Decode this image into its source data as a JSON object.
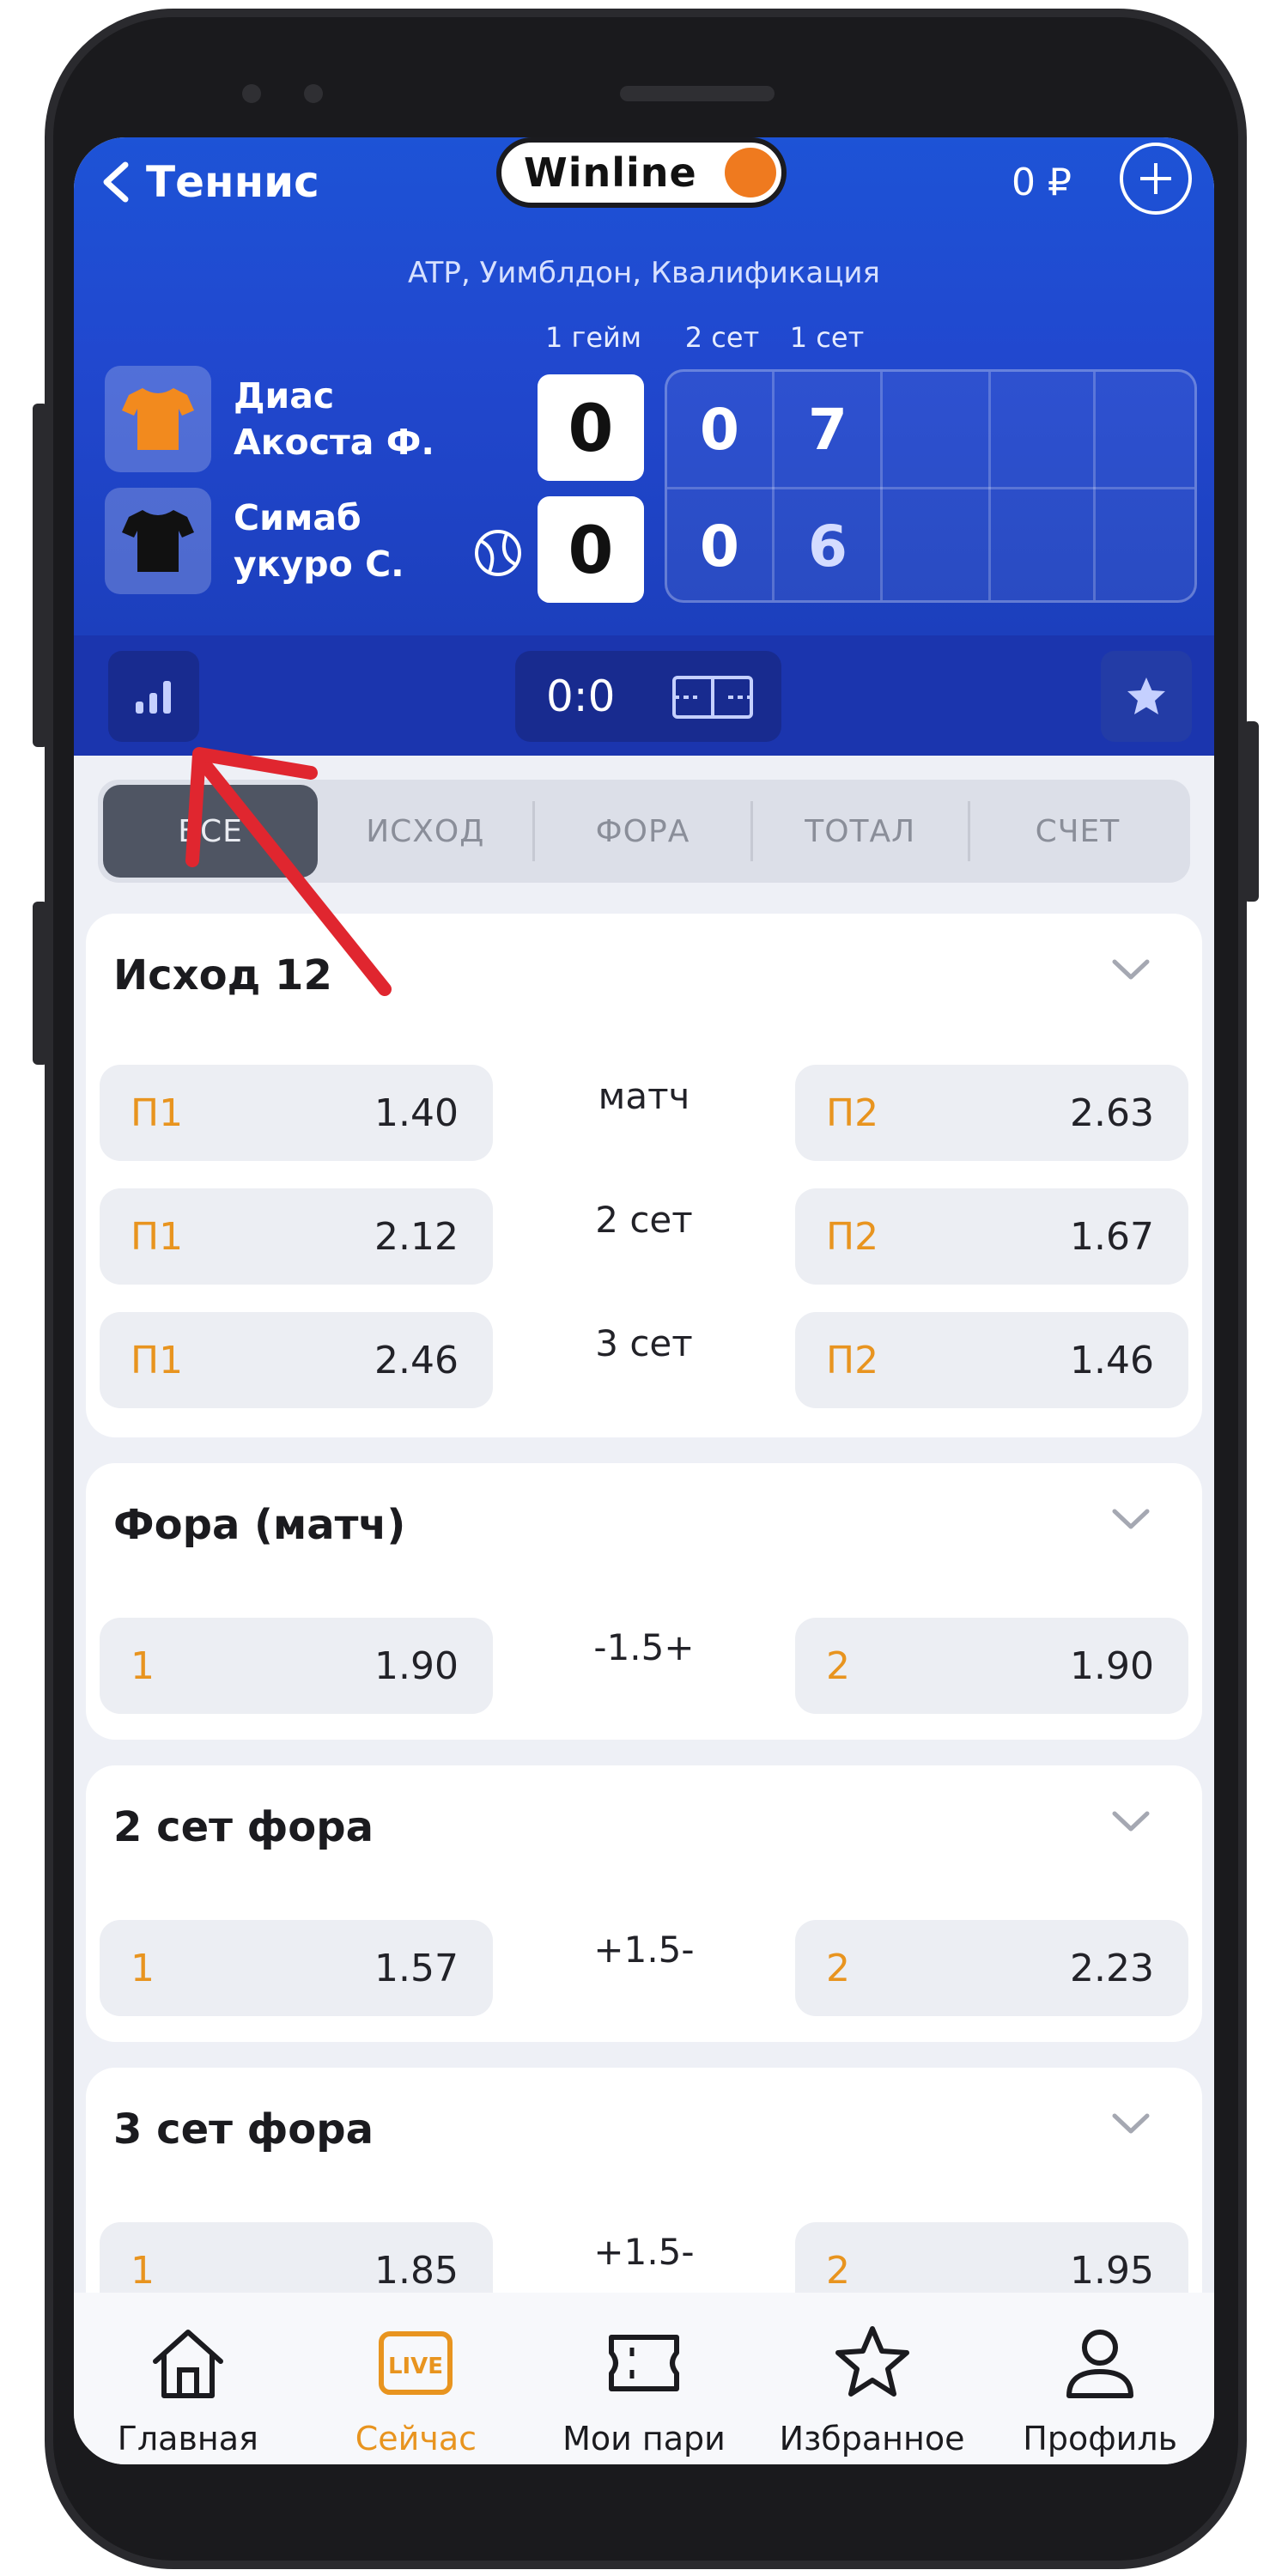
{
  "header": {
    "back_label": "Теннис",
    "logo_text": "Winline",
    "balance": "0 ₽",
    "tournament": "ATP, Уимблдон, Квалификация",
    "columns": {
      "game": "1 гейм",
      "set2": "2 сет",
      "set1": "1 сет"
    },
    "players": [
      {
        "name": "Диас\nАкоста Ф.",
        "game_score": "0",
        "set2": "0",
        "set1": "7",
        "jersey_color": "#f28a1e"
      },
      {
        "name": "Симаб\nукуро С.",
        "game_score": "0",
        "set2": "0",
        "set1": "6",
        "jersey_color": "#111111",
        "serving": true
      }
    ],
    "current_score": "0:0"
  },
  "tabs": [
    "ВСЕ",
    "ИСХОД",
    "ФОРА",
    "ТОТАЛ",
    "СЧЕТ"
  ],
  "active_tab": "ВСЕ",
  "markets": [
    {
      "title": "Исход 12",
      "rows": [
        {
          "left_label": "П1",
          "left_odd": "1.40",
          "middle": "матч",
          "right_label": "П2",
          "right_odd": "2.63"
        },
        {
          "left_label": "П1",
          "left_odd": "2.12",
          "middle": "2 сет",
          "right_label": "П2",
          "right_odd": "1.67"
        },
        {
          "left_label": "П1",
          "left_odd": "2.46",
          "middle": "3 сет",
          "right_label": "П2",
          "right_odd": "1.46"
        }
      ]
    },
    {
      "title": "Фора (матч)",
      "rows": [
        {
          "left_label": "1",
          "left_odd": "1.90",
          "middle": "-1.5+",
          "right_label": "2",
          "right_odd": "1.90"
        }
      ]
    },
    {
      "title": "2 сет фора",
      "rows": [
        {
          "left_label": "1",
          "left_odd": "1.57",
          "middle": "+1.5-",
          "right_label": "2",
          "right_odd": "2.23"
        }
      ]
    },
    {
      "title": "3 сет фора",
      "rows": [
        {
          "left_label": "1",
          "left_odd": "1.85",
          "middle": "+1.5-",
          "right_label": "2",
          "right_odd": "1.95"
        }
      ]
    }
  ],
  "bottom_nav": [
    {
      "label": "Главная",
      "icon": "home-icon"
    },
    {
      "label": "Сейчас",
      "icon": "live-icon",
      "badge": "LIVE",
      "active": true
    },
    {
      "label": "Мои пари",
      "icon": "ticket-icon"
    },
    {
      "label": "Избранное",
      "icon": "star-icon"
    },
    {
      "label": "Профиль",
      "icon": "profile-icon"
    }
  ],
  "colors": {
    "brand_blue": "#1d53d6",
    "accent_orange": "#e8941f",
    "annotation_red": "#e0262f"
  }
}
